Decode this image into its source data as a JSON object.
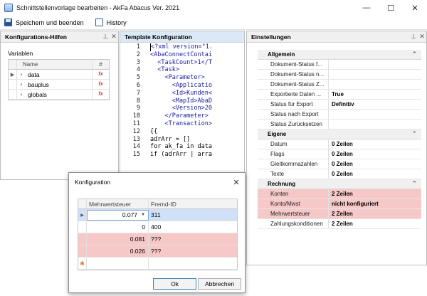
{
  "window": {
    "title": "Schnittstellenvorlage bearbeiten - AkFa Abacus Ver. 2021",
    "minimize": "—",
    "maximize": "☐",
    "close": "✕"
  },
  "toolbar": {
    "save_label": "Speichern und beenden",
    "history_label": "History"
  },
  "left_panel": {
    "title": "Konfigurations-Hilfen",
    "variables_label": "Variablen",
    "col_name": "Name",
    "col_hash": "#",
    "rows": [
      {
        "name": "data"
      },
      {
        "name": "bauplus"
      },
      {
        "name": "globals"
      }
    ]
  },
  "mid_panel": {
    "title": "Template Konfiguration",
    "lines": [
      {
        "n": "1",
        "t": "<?xml version=\"1."
      },
      {
        "n": "2",
        "t": "<AbaConnectContai"
      },
      {
        "n": "3",
        "t": "  <TaskCount>1</T"
      },
      {
        "n": "4",
        "t": "  <Task>"
      },
      {
        "n": "5",
        "t": "    <Parameter>"
      },
      {
        "n": "6",
        "t": "      <Applicatio"
      },
      {
        "n": "7",
        "t": "      <Id>Kunden<"
      },
      {
        "n": "8",
        "t": "      <MapId>AbaD"
      },
      {
        "n": "9",
        "t": "      <Version>20"
      },
      {
        "n": "10",
        "t": "    </Parameter>"
      },
      {
        "n": "11",
        "t": "    <Transaction>"
      },
      {
        "n": "12",
        "t": "{{"
      },
      {
        "n": "13",
        "t": "adrArr = []"
      },
      {
        "n": "14",
        "t": "for ak_fa in data"
      },
      {
        "n": "15",
        "t": "if (adrArr | arra"
      }
    ]
  },
  "right_panel": {
    "title": "Einstellungen",
    "categories": [
      {
        "name": "Allgemein",
        "rows": [
          {
            "name": "Dokument-Status f...",
            "value": ""
          },
          {
            "name": "Dokument-Status n...",
            "value": ""
          },
          {
            "name": "Dokument-Status Z...",
            "value": ""
          },
          {
            "name": "Exportierte Daten ...",
            "value": "True"
          },
          {
            "name": "Status für Export",
            "value": "Definitiv"
          },
          {
            "name": "Status nach Export",
            "value": ""
          },
          {
            "name": "Status Zurücksetzen",
            "value": ""
          }
        ]
      },
      {
        "name": "Eigene",
        "rows": [
          {
            "name": "Datum",
            "value": "0 Zeilen"
          },
          {
            "name": "Flags",
            "value": "0 Zeilen"
          },
          {
            "name": "Gleitkommazahlen",
            "value": "0 Zeilen"
          },
          {
            "name": "Texte",
            "value": "0 Zeilen"
          }
        ]
      },
      {
        "name": "Rechnung",
        "rows": [
          {
            "name": "Konten",
            "value": "2 Zeilen",
            "highlight": true
          },
          {
            "name": "Konto/Mwst",
            "value": "nicht konfiguriert",
            "highlight": true
          },
          {
            "name": "Mehrwertsteuer",
            "value": "2 Zeilen",
            "highlight": true
          },
          {
            "name": "Zahlungskonditionen",
            "value": "2 Zeilen",
            "highlight": false
          }
        ]
      }
    ]
  },
  "dialog": {
    "title": "Konfiguration",
    "close": "✕",
    "col_mwst": "Mehrwertsteuer",
    "col_fremd": "Fremd-ID",
    "rows": [
      {
        "mwst": "0.077",
        "fremd": "311",
        "selected": true,
        "red": false
      },
      {
        "mwst": "0",
        "fremd": "400",
        "selected": false,
        "red": false
      },
      {
        "mwst": "0.081",
        "fremd": "???",
        "selected": false,
        "red": true
      },
      {
        "mwst": "0.026",
        "fremd": "???",
        "selected": false,
        "red": true
      },
      {
        "mwst": "",
        "fremd": "",
        "selected": false,
        "red": false,
        "new": true
      }
    ],
    "ok_label": "Ok",
    "cancel_label": "Abbrechen"
  },
  "colors": {
    "highlight": "#f7c8c8",
    "highlight_border": "#e46a6a",
    "xml_tag": "#1a1aa6",
    "selection": "#cfe0f7"
  }
}
